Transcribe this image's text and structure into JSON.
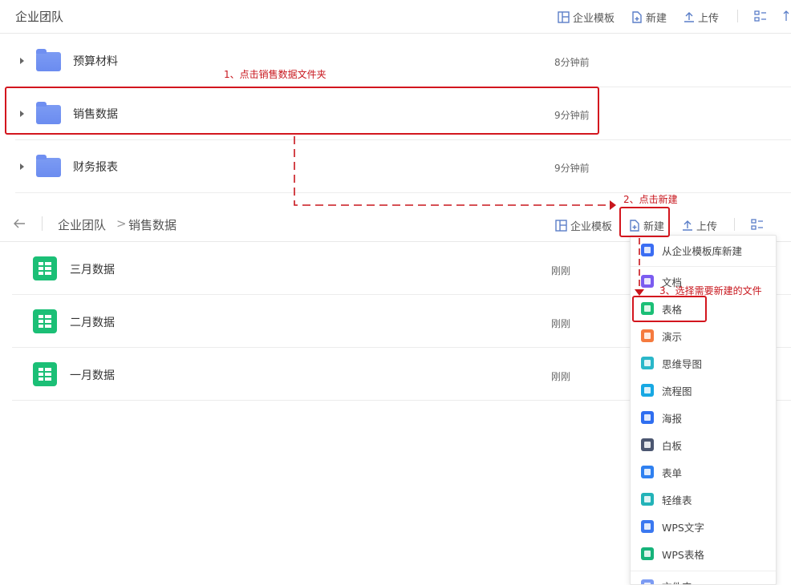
{
  "top": {
    "title": "企业团队",
    "template_label": "企业模板",
    "new_label": "新建",
    "upload_label": "上传"
  },
  "folders": [
    {
      "name": "预算材料",
      "time": "8分钟前"
    },
    {
      "name": "销售数据",
      "time": "9分钟前"
    },
    {
      "name": "财务报表",
      "time": "9分钟前"
    }
  ],
  "breadcrumb": {
    "root": "企业团队",
    "separator": ">",
    "current": "销售数据",
    "template_label": "企业模板",
    "new_label": "新建",
    "upload_label": "上传"
  },
  "files": [
    {
      "name": "三月数据",
      "time": "刚刚"
    },
    {
      "name": "二月数据",
      "time": "刚刚"
    },
    {
      "name": "一月数据",
      "time": "刚刚"
    }
  ],
  "menu": {
    "items": [
      {
        "label": "从企业模板库新建",
        "color": "#3b6df3"
      },
      {
        "label": "文档",
        "color": "#7b5cf0"
      },
      {
        "label": "表格",
        "color": "#1bbf76"
      },
      {
        "label": "演示",
        "color": "#f57a3e"
      },
      {
        "label": "思维导图",
        "color": "#2ab7c9"
      },
      {
        "label": "流程图",
        "color": "#17a8e3"
      },
      {
        "label": "海报",
        "color": "#2f6ef0"
      },
      {
        "label": "白板",
        "color": "#4b5670"
      },
      {
        "label": "表单",
        "color": "#2f80f0"
      },
      {
        "label": "轻维表",
        "color": "#23b3b8"
      },
      {
        "label": "WPS文字",
        "color": "#3a78f0"
      },
      {
        "label": "WPS表格",
        "color": "#16b37a"
      },
      {
        "label": "文件夹",
        "color": "#7c9bf3"
      }
    ]
  },
  "annotations": {
    "step1": "1、点击销售数据文件夹",
    "step2": "2、点击新建",
    "step3": "3、选择需要新建的文件"
  }
}
